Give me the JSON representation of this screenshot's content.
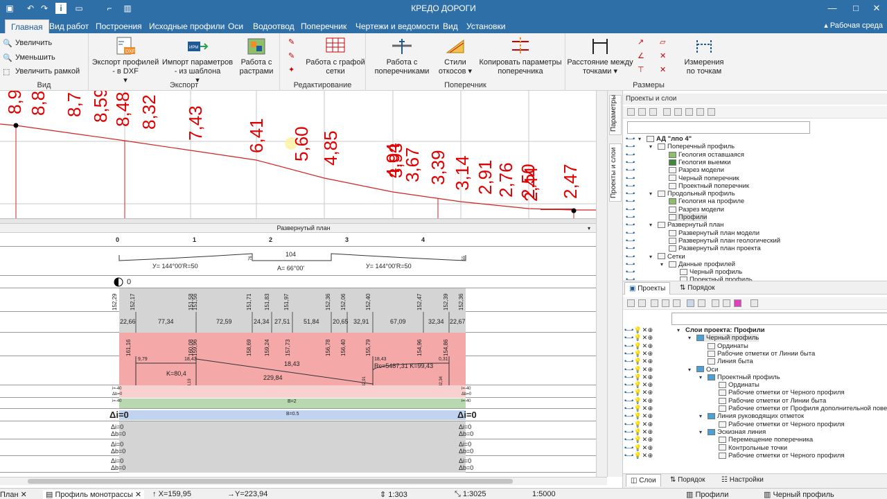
{
  "app": {
    "title": "КРЕДО ДОРОГИ",
    "workspace": "Рабочая среда"
  },
  "tabs": [
    "Главная",
    "Вид работ",
    "Построения",
    "Исходные профили",
    "Оси",
    "Водоотвод",
    "Поперечник",
    "Чертежи и ведомости",
    "Вид",
    "Установки"
  ],
  "ribbon": {
    "view": {
      "zoom_in": "Увеличить",
      "zoom_out": "Уменьшить",
      "zoom_frame": "Увеличить рамкой",
      "title": "Вид"
    },
    "export": {
      "dxf_line1": "Экспорт профилей",
      "dxf_line2": "- в DXF",
      "imp_line1": "Импорт параметров",
      "imp_line2": "- из шаблона",
      "raster_line1": "Работа с",
      "raster_line2": "растрами",
      "title": "Экспорт"
    },
    "edit": {
      "grid_line1": "Работа с графой",
      "grid_line2": "сетки",
      "title": "Редактирование"
    },
    "cross": {
      "work_line1": "Работа с",
      "work_line2": "поперечниками",
      "styles_line1": "Стили",
      "styles_line2": "откосов",
      "copy_line1": "Копировать параметры",
      "copy_line2": "поперечника",
      "title": "Поперечник"
    },
    "dims": {
      "dist_line1": "Расстояние между",
      "dist_line2": "точками",
      "meas_line1": "Измерения",
      "meas_line2": "по точкам",
      "title": "Размеры"
    }
  },
  "profile_labels": [
    "8,9",
    "8,8",
    "8,7",
    "8,59",
    "8,48",
    "8,32",
    "7,43",
    "6,41",
    "5,60",
    "4,85",
    "4,94",
    "3,93",
    "3,67",
    "3,39",
    "3,14",
    "2,91",
    "2,76",
    "2,50",
    "2,44",
    "2,47"
  ],
  "plan": {
    "title": "Развернутый план",
    "stations": [
      "0",
      "1",
      "2",
      "3",
      "4"
    ],
    "curve1": "У= 144°00'R=50",
    "curve2": "У= 144°00'R=50",
    "angle": "A= 66°00'",
    "straight": "104",
    "small1": "76",
    "small2": "55",
    "zero": "0",
    "elev1": [
      "152,29",
      "152,17",
      "151,58",
      "151,56",
      "151,71",
      "151,83",
      "151,97",
      "152,36",
      "152,06",
      "152,40",
      "152,47",
      "152,39",
      "152,36"
    ],
    "dist": [
      "22,66",
      "77,34",
      "72,59",
      "24,34",
      "27,51",
      "51,84",
      "20,65",
      "32,91",
      "67,09",
      "32,34",
      "22,67"
    ],
    "elev2": [
      "161,16",
      "160,08",
      "159,96",
      "158,69",
      "159,24",
      "157,73",
      "156,78",
      "156,40",
      "155,79",
      "154,96",
      "154,86"
    ],
    "slope1": "9,79",
    "slope2": "18,43",
    "slope3": "18,43",
    "slope4": "18,43",
    "slope5": "0,31",
    "k1": "K=80,4",
    "length": "229,84",
    "rc": "Rc=5487,31 K=99,43",
    "v1": "3,19",
    "v2": "32,91",
    "v3": "32,34",
    "di_i": "i=-40",
    "di_b": "Δb=0",
    "b2": "B=2",
    "b05": "B=0.5",
    "di_big": "Δi=0",
    "di0": "Δi=0",
    "db0": "Δb=0"
  },
  "right": {
    "title": "Проекты и слои",
    "tree1": [
      "АД \"лпо 4\"",
      "Поперечный профиль",
      "Геология оставшаяся",
      "Геология выемки",
      "Разрез модели",
      "Черный поперечник",
      "Проектный поперечник",
      "Продольный профиль",
      "Геология на профиле",
      "Разрез модели",
      "Профили",
      "Развернутый план",
      "Развернутый план модели",
      "Развернутый план геологический",
      "Развернутый план проекта",
      "Сетки",
      "Данные профилей",
      "Черный профиль",
      "Проектный профиль"
    ],
    "tabs_top": [
      "Проекты",
      "Порядок"
    ],
    "tree2": [
      "Слои проекта: Профили",
      "Черный профиль",
      "Ординаты",
      "Рабочие отметки от Линии быта",
      "Линия быта",
      "Оси",
      "Проектный профиль",
      "Ординаты",
      "Рабочие отметки от Черного профиля",
      "Рабочие отметки от Линии быта",
      "Рабочие отметки от Профиля дополнительной поверх",
      "Линия руководящих отметок",
      "Рабочие отметки от Черного профиля",
      "Эскизная линия",
      "Перемещение поперечника",
      "Контрольные точки",
      "Рабочие отметки от Черного профиля"
    ],
    "tabs_bottom": [
      "Слои",
      "Порядок",
      "Настройки"
    ]
  },
  "sidetabs": [
    "Параметры",
    "Проекты и слои"
  ],
  "status": {
    "tab1": "План",
    "tab2": "Профиль монотрассы",
    "x": "X=159,95",
    "y": "Y=223,94",
    "scale1": "1:303",
    "scale2": "1:3025",
    "scale3": "1:5000",
    "prof": "Профили",
    "black": "Черный профиль"
  }
}
